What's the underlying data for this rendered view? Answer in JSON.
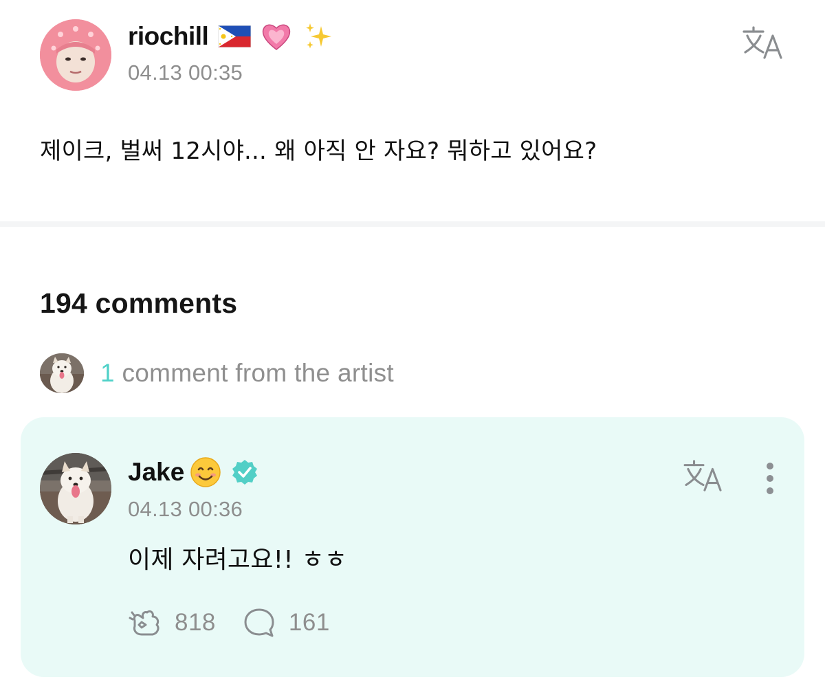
{
  "post": {
    "author": "riochill",
    "author_emojis": [
      "philippines-flag",
      "growing-heart",
      "sparkles"
    ],
    "timestamp": "04.13 00:35",
    "body": "제이크, 벌써 12시야... 왜 아직 안 자요? 뭐하고 있어요?",
    "translate_icon": "translate-icon"
  },
  "comments": {
    "count_label": "194 comments",
    "artist_summary": {
      "count": "1",
      "label": " comment from the artist"
    }
  },
  "artist_comment": {
    "author": "Jake",
    "author_emoji": "smiling-face",
    "verified": true,
    "timestamp": "04.13 00:36",
    "body": "이제 자려고요!! ㅎㅎ",
    "likes": "818",
    "replies": "161"
  },
  "colors": {
    "accent": "#4fd1c8",
    "card_background": "#e9faf7",
    "muted_text": "#8e8e8e"
  }
}
